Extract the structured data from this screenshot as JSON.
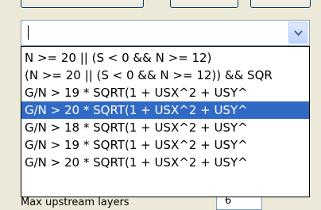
{
  "combo": {
    "value": ""
  },
  "dropdown": {
    "items": [
      {
        "label": "N >= 20 || (S < 0 && N >= 12)",
        "selected": false
      },
      {
        "label": "(N >= 20 || (S < 0 && N >= 12)) && SQR",
        "selected": false
      },
      {
        "label": "G/N > 19 * SQRT(1 + USX^2 + USY^",
        "selected": false
      },
      {
        "label": "G/N > 20 * SQRT(1 + USX^2 + USY^",
        "selected": true
      },
      {
        "label": "G/N > 18 * SQRT(1 + USX^2 + USY^",
        "selected": false
      },
      {
        "label": "G/N > 19 * SQRT(1 + USX^2 + USY^",
        "selected": false
      },
      {
        "label": "G/N > 20 * SQRT(1 + USX^2 + USY^",
        "selected": false
      }
    ]
  },
  "behind": {
    "label": "Max upstream layers",
    "value": "6"
  },
  "colors": {
    "selection": "#316ac5",
    "background": "#ece9d8",
    "border": "#7f9db9"
  }
}
